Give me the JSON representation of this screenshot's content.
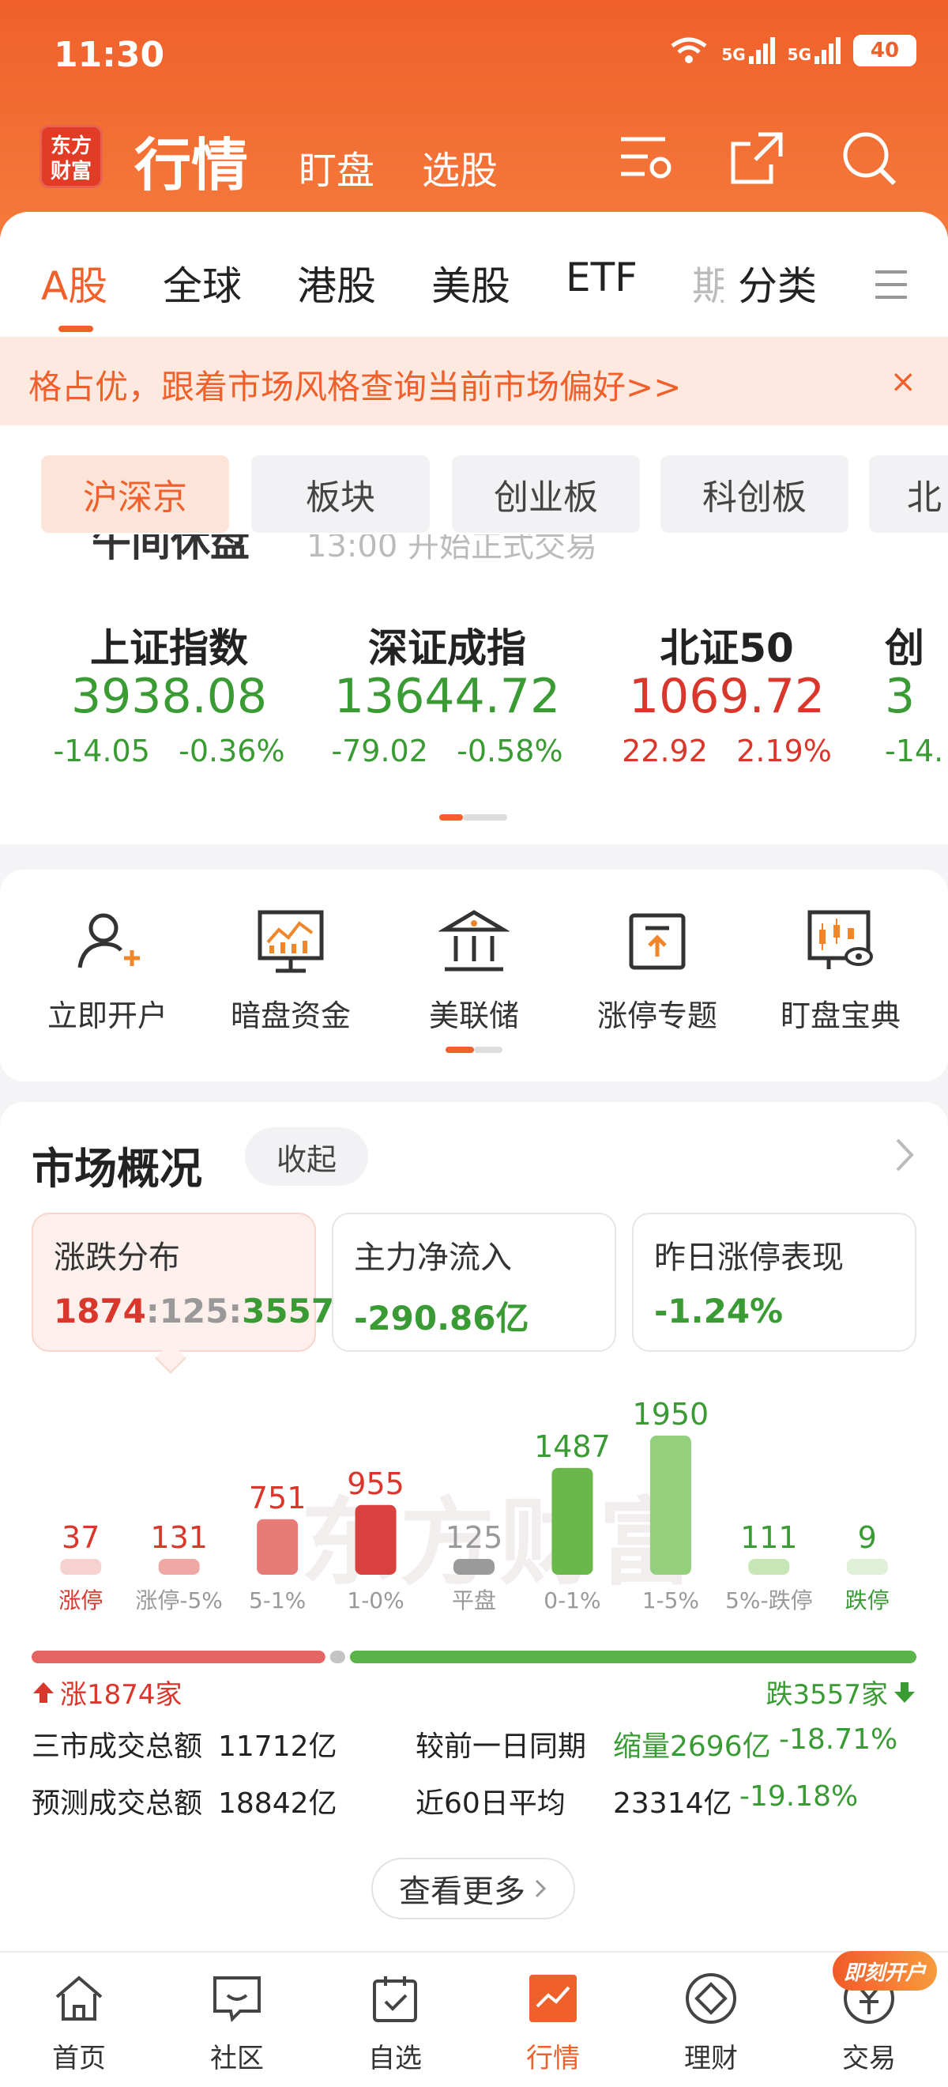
{
  "status_bar": {
    "time": "11:30",
    "net1": "5G",
    "net2": "5G",
    "battery": "40"
  },
  "header": {
    "logo_line1": "东方",
    "logo_line2": "财富",
    "title": "行情",
    "sub1": "盯盘",
    "sub2": "选股"
  },
  "tabs": [
    "A股",
    "全球",
    "港股",
    "美股",
    "ETF",
    "期",
    "分类"
  ],
  "banner": {
    "text": "格占优，跟着市场风格查询当前市场偏好>>",
    "close": "×"
  },
  "subtabs": [
    "沪深京",
    "板块",
    "创业板",
    "科创板",
    "北"
  ],
  "notice_partial": {
    "left": "午间休盘",
    "right": "13:00 开始正式交易"
  },
  "indices": [
    {
      "name": "上证指数",
      "value": "3938.08",
      "chg": "-14.05",
      "pct": "-0.36%",
      "dir": "down"
    },
    {
      "name": "深证成指",
      "value": "13644.72",
      "chg": "-79.02",
      "pct": "-0.58%",
      "dir": "down"
    },
    {
      "name": "北证50",
      "value": "1069.72",
      "chg": "22.92",
      "pct": "2.19%",
      "dir": "up"
    },
    {
      "name": "创",
      "value": "3",
      "chg": "-14.",
      "pct": "",
      "dir": "down"
    }
  ],
  "tools": [
    {
      "label": "立即开户",
      "icon": "add-user-icon"
    },
    {
      "label": "暗盘资金",
      "icon": "monitor-chart-icon"
    },
    {
      "label": "美联储",
      "icon": "bank-icon"
    },
    {
      "label": "涨停专题",
      "icon": "upload-box-icon"
    },
    {
      "label": "盯盘宝典",
      "icon": "candlestick-eye-icon"
    }
  ],
  "market": {
    "title": "市场概况",
    "collapse": "收起",
    "cards": [
      {
        "label": "涨跌分布",
        "up": "1874",
        "sep1": ":",
        "flat": "125",
        "sep2": ":",
        "down": "3557"
      },
      {
        "label": "主力净流入",
        "value": "-290.86亿"
      },
      {
        "label": "昨日涨停表现",
        "value": "-1.24%"
      }
    ],
    "watermark": "东方财富",
    "ratio": {
      "up_label": "涨1874家",
      "down_label": "跌3557家",
      "up": 1874,
      "flat": 125,
      "down": 3557
    },
    "turnover": {
      "row1": {
        "label": "三市成交总额",
        "value": "11712亿",
        "cmp_label": "较前一日同期",
        "cmp_value": "缩量2696亿",
        "cmp_pct": "-18.71%"
      },
      "row2": {
        "label": "预测成交总额",
        "value": "18842亿",
        "cmp_label": "近60日平均",
        "cmp_value": "23314亿",
        "cmp_pct": "-19.18%"
      }
    },
    "more": "查看更多"
  },
  "chart_data": {
    "type": "bar",
    "categories": [
      "涨停",
      "涨停-5%",
      "5-1%",
      "1-0%",
      "平盘",
      "0-1%",
      "1-5%",
      "5%-跌停",
      "跌停"
    ],
    "values": [
      37,
      131,
      751,
      955,
      125,
      1487,
      1950,
      111,
      9
    ],
    "colors": [
      "#f6d2cf",
      "#f0a8a4",
      "#e77b78",
      "#d9413e",
      "#9a9a9a",
      "#6ab84a",
      "#94cf7e",
      "#c6e6b6",
      "#dff0d6"
    ],
    "label_colors": [
      "#d9362c",
      "#d9362c",
      "#d9362c",
      "#d9362c",
      "#999999",
      "#3a9b34",
      "#3a9b34",
      "#3a9b34",
      "#3a9b34"
    ],
    "category_colors": [
      "#d9362c",
      "#999999",
      "#999999",
      "#999999",
      "#999999",
      "#999999",
      "#999999",
      "#999999",
      "#3a9b34"
    ],
    "ylim": [
      0,
      1950
    ]
  },
  "bottom_nav": [
    {
      "label": "首页",
      "icon": "home-icon"
    },
    {
      "label": "社区",
      "icon": "chat-icon"
    },
    {
      "label": "自选",
      "icon": "checklist-icon"
    },
    {
      "label": "行情",
      "icon": "market-chart-icon"
    },
    {
      "label": "理财",
      "icon": "diamond-icon"
    },
    {
      "label": "交易",
      "icon": "yuan-icon"
    }
  ],
  "promo": "即刻开户",
  "colors": {
    "accent": "#f0602a",
    "up": "#d9362c",
    "down": "#3a9b34"
  }
}
